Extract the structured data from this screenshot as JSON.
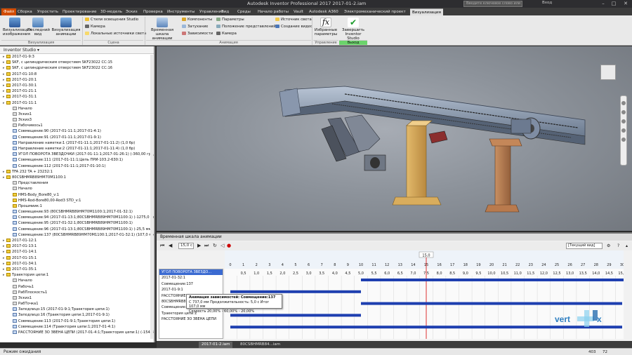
{
  "window": {
    "title": "Autodesk Inventor Professional 2017   2017-01-2.iam",
    "search_placeholder": "Введите ключевое слово или фразу",
    "user": "Вход",
    "min": "–",
    "max": "□",
    "close": "✕"
  },
  "ribbon_tabs": [
    "Файл",
    "Сборка",
    "Упростить",
    "Проектирование",
    "3D-модель",
    "Эскиз",
    "Проверка",
    "Инструменты",
    "Управление",
    "Вид",
    "Среды",
    "Начало работы",
    "Vault",
    "Autodesk A360",
    "Электромеханический проект",
    "Визуализация"
  ],
  "active_tab": "Визуализация",
  "ribbon": {
    "render_image": "Визуализация изображения",
    "last_view": "Последний вид",
    "render_anim": "Визуализация анимации",
    "group_render": "Визуализация",
    "scene_items": [
      "Стили освещения Studio",
      "Камера",
      "Локальные источники света"
    ],
    "group_scene": "Сцена",
    "timeline_btn": "Временная шкала анимации",
    "anim_col1": [
      "Компоненты",
      "Затухание",
      "Зависимости"
    ],
    "anim_col2": [
      "Параметры",
      "Положение представлений",
      "Камера"
    ],
    "anim_col3": [
      "Источник света",
      "Создание видео"
    ],
    "group_anim": "Анимация",
    "fav_params": "Избранные параметры",
    "group_manage": "Управление",
    "finish": "Завершить Inventor Studio",
    "group_exit": "Выход"
  },
  "browser": {
    "header": "Inventor Studio ▾",
    "items": [
      {
        "l": "2017-01-9:3",
        "d": 0,
        "i": "y"
      },
      {
        "l": "SKF, с цилиндрическим отверстием SKF23022 CC:15",
        "d": 0,
        "i": "y"
      },
      {
        "l": "SKF, с цилиндрическим отверстием SKF23022 CC:16",
        "d": 0,
        "i": "y"
      },
      {
        "l": "2017-01-10:8",
        "d": 0,
        "i": "y"
      },
      {
        "l": "2017-01-20:1",
        "d": 0,
        "i": "y"
      },
      {
        "l": "2017-01-30:1",
        "d": 0,
        "i": "y"
      },
      {
        "l": "2017-01-21:1",
        "d": 0,
        "i": "y"
      },
      {
        "l": "2017-01-31:1",
        "d": 0,
        "i": "y"
      },
      {
        "l": "2017-01-11:1",
        "d": 0,
        "i": "y"
      },
      {
        "l": "Начало",
        "d": 1,
        "i": "g"
      },
      {
        "l": "Эскиз1",
        "d": 1,
        "i": "g"
      },
      {
        "l": "Эскиз3",
        "d": 1,
        "i": "g"
      },
      {
        "l": "Рабочиеось1",
        "d": 1,
        "i": "g"
      },
      {
        "l": "Совмещение:90 (2017-01-11:1;2017-01-4:1)",
        "d": 1,
        "i": "n"
      },
      {
        "l": "Совмещение:91 (2017-01-11:1;2017-01-9:1)",
        "d": 1,
        "i": "n"
      },
      {
        "l": "Направление наметки:1 (2017-01-11:1;2017-01-11:2) (1,0 бр)",
        "d": 1,
        "i": "n"
      },
      {
        "l": "Направление наметки:2 (2017-01-11:1;2017-01-11:4) (1,0 бр)",
        "d": 1,
        "i": "n"
      },
      {
        "l": "УГОЛ ПОВОРОТА ЗВЕЗДОЧКИ (2017-01-11:1;2017-01-26:1) (-360,00 град)",
        "d": 1,
        "i": "n"
      },
      {
        "l": "Совмещение:111 (2017-01-11:1;Цепь ПРИ-103.2-630:1)",
        "d": 1,
        "i": "n"
      },
      {
        "l": "Совмещение:112 (2017-01-11:1;2017-01-10:1)",
        "d": 1,
        "i": "n"
      },
      {
        "l": "TFA 232 TA + 23232:1",
        "d": 0,
        "i": "y"
      },
      {
        "l": "80CSBHMRB89HM70M1100:1",
        "d": 0,
        "i": "y"
      },
      {
        "l": "Представления",
        "d": 1,
        "i": "g"
      },
      {
        "l": "Начало",
        "d": 1,
        "i": "g"
      },
      {
        "l": "HMS-Body_Bore80_v:1",
        "d": 1,
        "i": "y"
      },
      {
        "l": "HMS-Rod-Bore80,00-Rod3 STD_v:1",
        "d": 1,
        "i": "y"
      },
      {
        "l": "Прошмиик:1",
        "d": 1,
        "i": "y"
      },
      {
        "l": "Совмещение:93 (80CSBHMRB89HM70M1100:1;2017-01-32:1)",
        "d": 1,
        "i": "n"
      },
      {
        "l": "Совмещение:94 (2017-01-13:1;80CSBHMRB89HM70M1100:1) (-1275,0 мм)",
        "d": 1,
        "i": "n"
      },
      {
        "l": "Совмещение:95 (2017-01-32:1;80CSBHMRB89HM70M1100:1)",
        "d": 1,
        "i": "n"
      },
      {
        "l": "Совмещение:96 (2017-01-13:1;80CSBHMRB89HM70M1100:1) (-25,5 мм)",
        "d": 1,
        "i": "n"
      },
      {
        "l": "Совмещение:137 (80CSBHMRB89HM70M1100:1;2017-01-32:1) (107,0 мм)",
        "d": 1,
        "i": "n"
      },
      {
        "l": "2017-01-12:1",
        "d": 0,
        "i": "y"
      },
      {
        "l": "2017-01-13:1",
        "d": 0,
        "i": "y"
      },
      {
        "l": "2017-01-14:1",
        "d": 0,
        "i": "y"
      },
      {
        "l": "2017-01-15:1",
        "d": 0,
        "i": "y"
      },
      {
        "l": "2017-01-34:1",
        "d": 0,
        "i": "y"
      },
      {
        "l": "2017-01-35:1",
        "d": 0,
        "i": "y"
      },
      {
        "l": "Траектория цепи:1",
        "d": 0,
        "i": "y"
      },
      {
        "l": "Начало",
        "d": 1,
        "i": "g"
      },
      {
        "l": "Рабочь1",
        "d": 1,
        "i": "g"
      },
      {
        "l": "РабПлоскость1",
        "d": 1,
        "i": "g"
      },
      {
        "l": "Эскиз1",
        "d": 1,
        "i": "g"
      },
      {
        "l": "РабТочка1",
        "d": 1,
        "i": "g"
      },
      {
        "l": "Заподлицо:15 (2017-01-9:1;Траектория цепи:1)",
        "d": 1,
        "i": "n"
      },
      {
        "l": "Заподлицо:16 (Траектория цепи:1;2017-01-9:1)",
        "d": 1,
        "i": "n"
      },
      {
        "l": "Совмещение:113 (2017-01-9:1;Траектория цепи:1)",
        "d": 1,
        "i": "n"
      },
      {
        "l": "Совмещение:114 (Траектория цепи:1;2017-01-4:1)",
        "d": 1,
        "i": "n"
      },
      {
        "l": "РАССТОЯНИЕ ЗО ЗВЕНА ЦЕПИ (2017-01-4:1;Траектория цепи:1) (-154,8 мм)",
        "d": 1,
        "i": "n"
      }
    ]
  },
  "timeline": {
    "title": "Временная шкала анимации",
    "time": "15,0 с",
    "view": "[Текущий вид]",
    "marker": "15,0",
    "ticks_top": [
      "0",
      "1",
      "2",
      "3",
      "4",
      "5",
      "6",
      "7",
      "8",
      "9",
      "10",
      "11",
      "12",
      "13",
      "14",
      "15",
      "16",
      "17",
      "18",
      "19",
      "20",
      "21",
      "22",
      "23",
      "24",
      "25",
      "26",
      "27",
      "28",
      "29",
      "30"
    ],
    "ticks_bot": [
      "0,5",
      "1,0",
      "1,5",
      "2,0",
      "2,5",
      "3,0",
      "3,5",
      "4,0",
      "4,5",
      "5,0",
      "5,5",
      "6,0",
      "6,5",
      "7,0",
      "7,5",
      "8,0",
      "8,5",
      "9,0",
      "9,5",
      "10,0",
      "10,5",
      "11,0",
      "11,5",
      "12,0",
      "12,5",
      "13,0",
      "13,5",
      "14,0",
      "14,5",
      "15,0"
    ],
    "rows": [
      "УГОЛ ПОВОРОТА ЗВЕЗДО...",
      "2017-01-32:1",
      "Совмещение:137",
      "2017-01-9:1",
      "РАССТОЯНИЕ...",
      "80CSBHMRB89H...",
      "Совмещение:137",
      "Траектория цепи:1",
      "РАССТОЯНИЕ ЗО ЗВЕНА ЦЕПИ"
    ],
    "tip": {
      "h": "Анимация зависимостей: Совмещение:137",
      "l1": "С 737,0 мм  Продолжительность: 5,0 с  Итог 107,0 мм",
      "l2": "Скорость 20,00% - 60,00% - 20,00%"
    }
  },
  "doc_tabs": [
    "2017-01-2.iam",
    "80CSBHMRB84...iam"
  ],
  "status": {
    "text": "Режим ожидания",
    "n1": "403",
    "n2": "72"
  },
  "watermark": "vertex"
}
